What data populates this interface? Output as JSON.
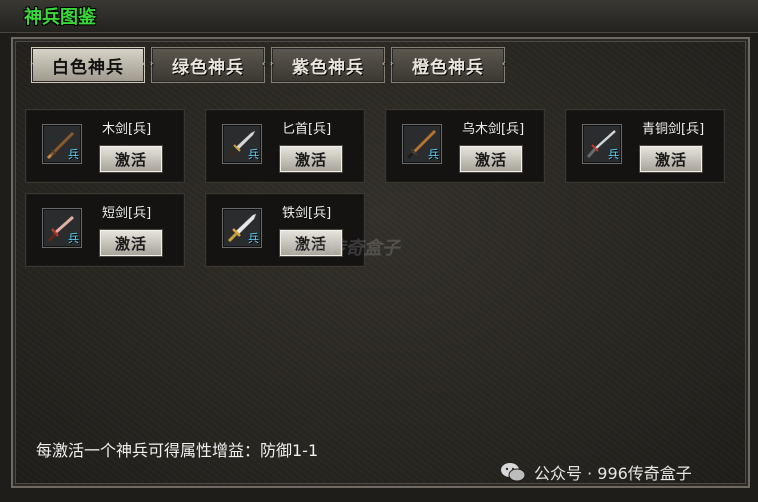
{
  "window": {
    "title": "神兵图鉴"
  },
  "tabs": [
    {
      "label": "白色神兵",
      "active": true
    },
    {
      "label": "绿色神兵",
      "active": false
    },
    {
      "label": "紫色神兵",
      "active": false
    },
    {
      "label": "橙色神兵",
      "active": false
    }
  ],
  "weapons": [
    {
      "name": "木剑[兵]",
      "tag": "兵",
      "button": "激活",
      "icon": "wooden-sword"
    },
    {
      "name": "匕首[兵]",
      "tag": "兵",
      "button": "激活",
      "icon": "dagger"
    },
    {
      "name": "乌木剑[兵]",
      "tag": "兵",
      "button": "激活",
      "icon": "ebony-sword"
    },
    {
      "name": "青铜剑[兵]",
      "tag": "兵",
      "button": "激活",
      "icon": "bronze-sword"
    },
    {
      "name": "短剑[兵]",
      "tag": "兵",
      "button": "激活",
      "icon": "short-sword"
    },
    {
      "name": "铁剑[兵]",
      "tag": "兵",
      "button": "激活",
      "icon": "iron-sword"
    }
  ],
  "footer": {
    "bonus_text": "每激活一个神兵可得属性增益：防御1-1"
  },
  "watermark": {
    "text": "996传奇盒子"
  },
  "credit": {
    "text": "公众号 · 996传奇盒子"
  },
  "colors": {
    "title": "#3bd83b",
    "tag": "#5ad8ff",
    "accent": "#e6e3dc"
  }
}
